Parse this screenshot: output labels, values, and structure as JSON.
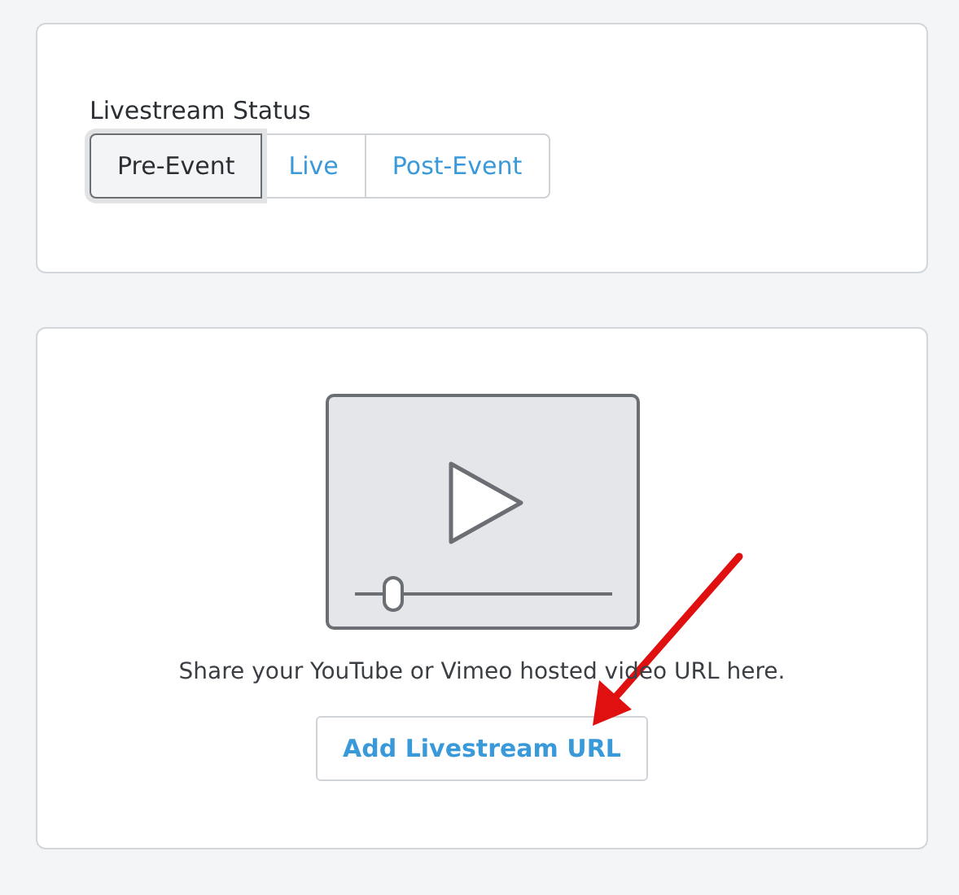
{
  "status_card": {
    "label": "Livestream Status",
    "options": [
      {
        "label": "Pre-Event",
        "selected": true
      },
      {
        "label": "Live",
        "selected": false
      },
      {
        "label": "Post-Event",
        "selected": false
      }
    ]
  },
  "livestream_card": {
    "hint": "Share your YouTube or Vimeo hosted video URL here.",
    "button": "Add Livestream URL"
  }
}
